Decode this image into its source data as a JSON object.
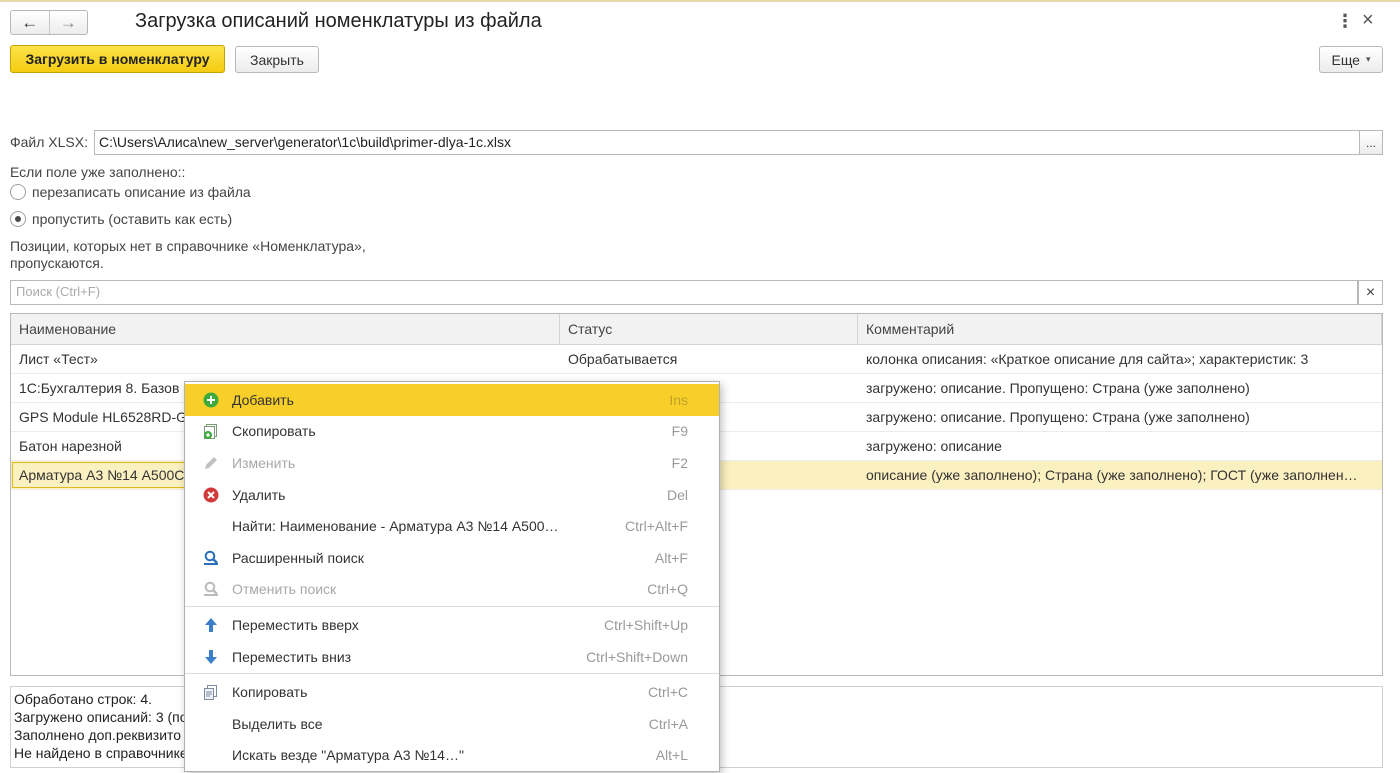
{
  "window": {
    "title": "Загрузка описаний номенклатуры из файла",
    "more_icon": "⋮",
    "close_icon": "×"
  },
  "nav": {
    "back": "←",
    "forward": "→"
  },
  "toolbar": {
    "load_button": "Загрузить в номенклатуру",
    "close_button": "Закрыть",
    "more_button": "Еще",
    "more_caret": "▾"
  },
  "file": {
    "label": "Файл XLSX:",
    "path": "C:\\Users\\Алиса\\new_server\\generator\\1c\\build\\primer-dlya-1c.xlsx",
    "select_button": "..."
  },
  "options": {
    "question": "Если поле уже заполнено::",
    "overwrite": "перезаписать описание из файла",
    "skip": "пропустить (оставить как есть)",
    "selected": "skip"
  },
  "note": {
    "line1": "Позиции, которых нет в справочнике «Номенклатура»,",
    "line2": "пропускаются."
  },
  "search": {
    "placeholder": "Поиск (Ctrl+F)",
    "clear": "×"
  },
  "table": {
    "columns": [
      "Наименование",
      "Статус",
      "Комментарий"
    ],
    "rows": [
      [
        "Лист «Тест»",
        "Обрабатывается",
        "колонка описания: «Краткое описание для сайта»; характеристик: 3"
      ],
      [
        "1С:Бухгалтерия 8. Базов",
        "",
        "загружено: описание. Пропущено: Страна (уже заполнено)"
      ],
      [
        "GPS Module HL6528RD-G",
        "",
        "загружено: описание. Пропущено: Страна (уже заполнено)"
      ],
      [
        "Батон нарезной",
        "",
        "загружено: описание"
      ],
      [
        "Арматура А3 №14 А500С",
        "",
        "описание (уже заполнено); Страна (уже заполнено); ГОСТ (уже заполнен…"
      ]
    ]
  },
  "log": {
    "lines": [
      "Обработано строк: 4.",
      "Загружено описаний: 3 (по",
      "Заполнено доп.реквизито",
      "Не найдено в справочнике"
    ]
  },
  "context_menu": {
    "items": [
      {
        "label": "Добавить",
        "shortcut": "Ins"
      },
      {
        "label": "Скопировать",
        "shortcut": "F9"
      },
      {
        "label": "Изменить",
        "shortcut": "F2"
      },
      {
        "label": "Удалить",
        "shortcut": "Del"
      },
      {
        "label": "Найти: Наименование - Арматура А3 №14 А500…",
        "shortcut": "Ctrl+Alt+F"
      },
      {
        "label": "Расширенный поиск",
        "shortcut": "Alt+F"
      },
      {
        "label": "Отменить поиск",
        "shortcut": "Ctrl+Q"
      },
      {
        "label": "Переместить вверх",
        "shortcut": "Ctrl+Shift+Up"
      },
      {
        "label": "Переместить вниз",
        "shortcut": "Ctrl+Shift+Down"
      },
      {
        "label": "Копировать",
        "shortcut": "Ctrl+C"
      },
      {
        "label": "Выделить все",
        "shortcut": "Ctrl+A"
      },
      {
        "label": "Искать везде \"Арматура А3 №14…\"",
        "shortcut": "Alt+L"
      }
    ]
  },
  "colors": {
    "accent_yellow": "#f7cf28",
    "selected_row": "#fbf0c0",
    "add_icon_green": "#3cab3c",
    "delete_icon_red": "#d23a3a",
    "arrow_icon_blue": "#3a7fc8"
  }
}
